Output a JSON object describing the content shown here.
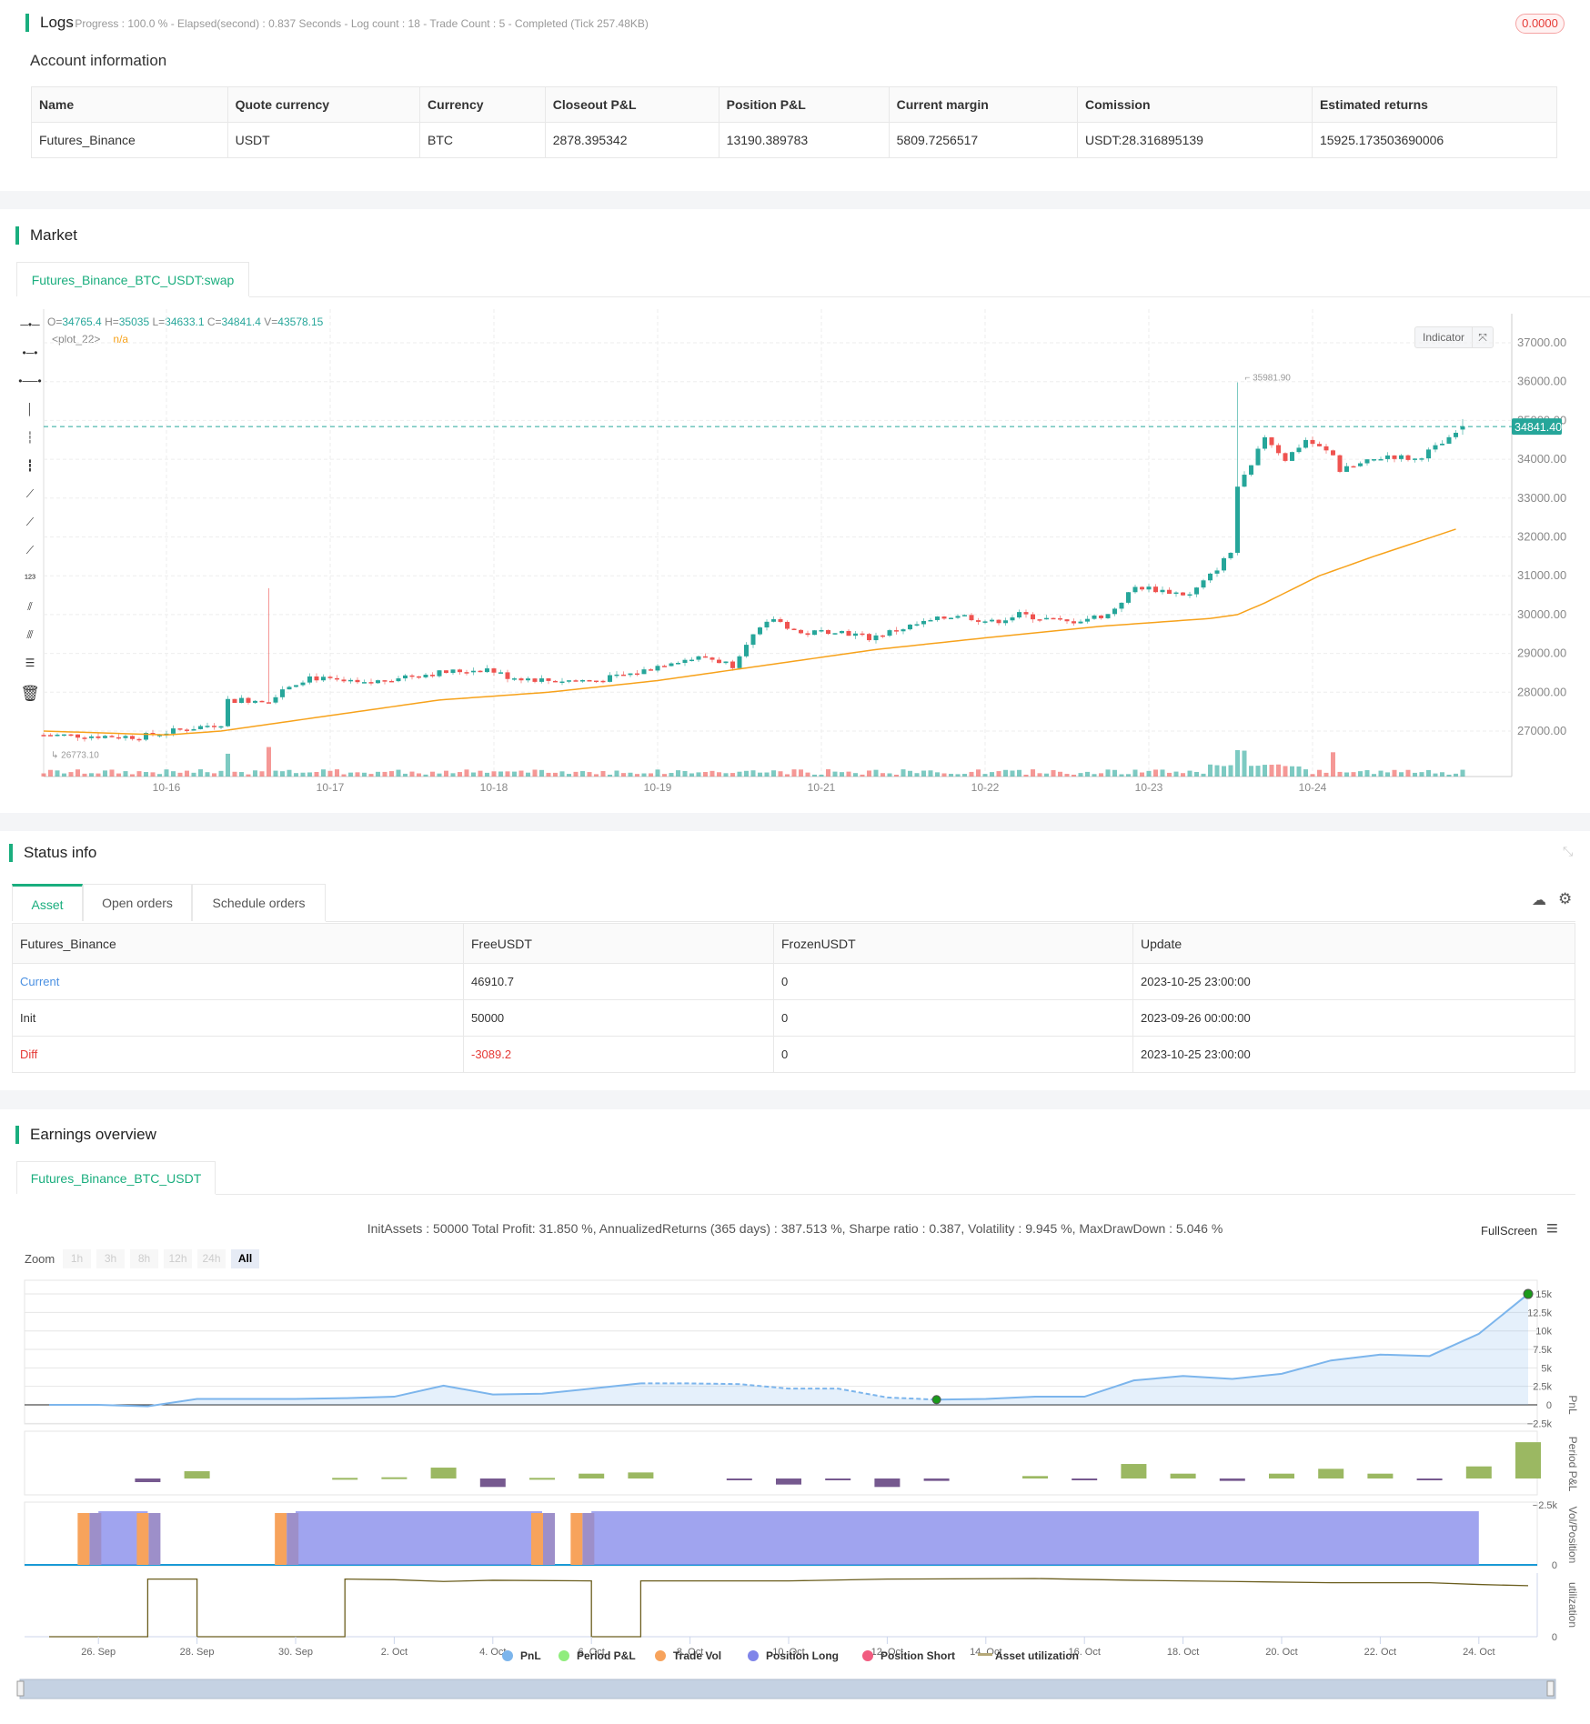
{
  "logs": {
    "title": "Logs",
    "progress": "- Progress : 100.0 % - Elapsed(second) : 0.837  Seconds - Log count : 18 - Trade Count : 5 - Completed (Tick 257.48KB)",
    "badge": "0.0000"
  },
  "account": {
    "title": "Account information",
    "headers": [
      "Name",
      "Quote currency",
      "Currency",
      "Closeout P&L",
      "Position P&L",
      "Current margin",
      "Comission",
      "Estimated returns"
    ],
    "row": [
      "Futures_Binance",
      "USDT",
      "BTC",
      "2878.395342",
      "13190.389783",
      "5809.7256517",
      "USDT:28.316895139",
      "15925.173503690006"
    ]
  },
  "market": {
    "title": "Market",
    "tab": "Futures_Binance_BTC_USDT:swap",
    "ohlc": {
      "o_label": "O=",
      "o": "34765.4",
      "h_label": " H=",
      "h": "35035",
      "l_label": " L=",
      "l": "34633.1",
      "c_label": " C=",
      "c": "34841.4",
      "v_label": " V=",
      "v": "43578.15"
    },
    "plot_label": "<plot_22>",
    "plot_value": "n/a",
    "indicator_btn": "Indicator",
    "last_price": "34841.40",
    "high_marker": "35981.90",
    "low_marker": "26773.10",
    "y_ticks": [
      37000,
      36000,
      35000,
      34000,
      33000,
      32000,
      31000,
      30000,
      29000,
      28000,
      27000
    ],
    "y_tick_labels": [
      "37000.00",
      "36000.00",
      "35000.00",
      "34000.00",
      "33000.00",
      "32000.00",
      "31000.00",
      "30000.00",
      "29000.00",
      "28000.00",
      "27000.00"
    ],
    "x_ticks": [
      {
        "h": 18,
        "label": "10-16"
      },
      {
        "h": 42,
        "label": "10-17"
      },
      {
        "h": 66,
        "label": "10-18"
      },
      {
        "h": 90,
        "label": "10-19"
      },
      {
        "h": 114,
        "label": "10-21"
      },
      {
        "h": 138,
        "label": "10-22"
      },
      {
        "h": 162,
        "label": "10-23"
      },
      {
        "h": 186,
        "label": "10-24"
      }
    ],
    "close_anchors": [
      [
        0,
        26900
      ],
      [
        14,
        26850
      ],
      [
        19,
        27000
      ],
      [
        26,
        27200
      ],
      [
        27,
        27800
      ],
      [
        33,
        27800
      ],
      [
        35,
        28100
      ],
      [
        39,
        28400
      ],
      [
        42,
        28300
      ],
      [
        47,
        28200
      ],
      [
        52,
        28400
      ],
      [
        58,
        28500
      ],
      [
        65,
        28600
      ],
      [
        68,
        28400
      ],
      [
        74,
        28300
      ],
      [
        81,
        28300
      ],
      [
        87,
        28500
      ],
      [
        92,
        28800
      ],
      [
        97,
        28900
      ],
      [
        101,
        28700
      ],
      [
        103,
        29300
      ],
      [
        107,
        29900
      ],
      [
        111,
        29500
      ],
      [
        116,
        29600
      ],
      [
        121,
        29400
      ],
      [
        127,
        29700
      ],
      [
        134,
        30000
      ],
      [
        139,
        29800
      ],
      [
        143,
        30000
      ],
      [
        150,
        29800
      ],
      [
        156,
        30000
      ],
      [
        160,
        30700
      ],
      [
        161,
        30700
      ],
      [
        168,
        30500
      ],
      [
        171,
        31000
      ],
      [
        174,
        31600
      ],
      [
        175,
        33300
      ],
      [
        177,
        33800
      ],
      [
        179,
        34600
      ],
      [
        182,
        34000
      ],
      [
        185,
        34500
      ],
      [
        189,
        34100
      ],
      [
        190,
        33700
      ],
      [
        197,
        34100
      ],
      [
        201,
        34000
      ],
      [
        206,
        34500
      ],
      [
        208,
        34841
      ]
    ],
    "ma_anchors": [
      [
        0,
        27000
      ],
      [
        18,
        26900
      ],
      [
        26,
        27000
      ],
      [
        42,
        27400
      ],
      [
        58,
        27800
      ],
      [
        74,
        28000
      ],
      [
        90,
        28300
      ],
      [
        106,
        28700
      ],
      [
        122,
        29100
      ],
      [
        138,
        29400
      ],
      [
        155,
        29700
      ],
      [
        171,
        29900
      ],
      [
        175,
        30000
      ],
      [
        179,
        30300
      ],
      [
        187,
        31000
      ],
      [
        195,
        31500
      ],
      [
        207,
        32200
      ]
    ],
    "spikes": [
      {
        "h": 33,
        "high": 30680
      },
      {
        "h": 175,
        "high": 35981.9
      }
    ],
    "colors": {
      "up": "#26a69a",
      "down": "#ef5350",
      "ma": "#f7a21b"
    }
  },
  "status": {
    "title": "Status info",
    "tabs": [
      "Asset",
      "Open orders",
      "Schedule orders"
    ],
    "headers": [
      "Futures_Binance",
      "FreeUSDT",
      "FrozenUSDT",
      "Update"
    ],
    "rows": [
      [
        "Current",
        "46910.7",
        "0",
        "2023-10-25 23:00:00"
      ],
      [
        "Init",
        "50000",
        "0",
        "2023-09-26 00:00:00"
      ],
      [
        "Diff",
        "-3089.2",
        "0",
        "2023-10-25 23:00:00"
      ]
    ]
  },
  "earnings": {
    "title": "Earnings overview",
    "tab": "Futures_Binance_BTC_USDT",
    "stats": "InitAssets : 50000 Total Profit: 31.850 %, AnnualizedReturns (365 days) : 387.513 %, Sharpe ratio : 0.387, Volatility : 9.945 %, MaxDrawDown : 5.046 %",
    "fullscreen": "FullScreen",
    "zoom_label": "Zoom",
    "zoom_buttons": [
      "1h",
      "3h",
      "8h",
      "12h",
      "24h",
      "All"
    ],
    "pnl_ticks": [
      {
        "v": 15000,
        "l": "15k"
      },
      {
        "v": 12500,
        "l": "12.5k"
      },
      {
        "v": 10000,
        "l": "10k"
      },
      {
        "v": 7500,
        "l": "7.5k"
      },
      {
        "v": 5000,
        "l": "5k"
      },
      {
        "v": 2500,
        "l": "2.5k"
      },
      {
        "v": 0,
        "l": "0"
      },
      {
        "v": -2500,
        "l": "−2.5k"
      }
    ],
    "axis_titles": [
      "PnL",
      "Period P&L",
      "Vol/Position",
      "utilization"
    ],
    "period_min_label": "−2.5k",
    "zero_label": "0",
    "x_labels": [
      {
        "d": 1,
        "l": "26. Sep"
      },
      {
        "d": 3,
        "l": "28. Sep"
      },
      {
        "d": 5,
        "l": "30. Sep"
      },
      {
        "d": 7,
        "l": "2. Oct"
      },
      {
        "d": 9,
        "l": "4. Oct"
      },
      {
        "d": 11,
        "l": "6. Oct"
      },
      {
        "d": 13,
        "l": "8. Oct"
      },
      {
        "d": 15,
        "l": "10. Oct"
      },
      {
        "d": 17,
        "l": "12. Oct"
      },
      {
        "d": 19,
        "l": "14. Oct"
      },
      {
        "d": 21,
        "l": "16. Oct"
      },
      {
        "d": 23,
        "l": "18. Oct"
      },
      {
        "d": 25,
        "l": "20. Oct"
      },
      {
        "d": 27,
        "l": "22. Oct"
      },
      {
        "d": 29,
        "l": "24. Oct"
      }
    ],
    "pnl": [
      0,
      0,
      -200,
      800,
      800,
      800,
      900,
      1100,
      2600,
      1400,
      1500,
      2200,
      2900,
      2900,
      2800,
      2200,
      2200,
      1000,
      700,
      800,
      1100,
      1100,
      3300,
      3900,
      3500,
      4200,
      6000,
      6800,
      6600,
      9600,
      15000
    ],
    "drawdown_range": [
      12,
      18
    ],
    "period_pnl": [
      [
        2,
        -300
      ],
      [
        3,
        600
      ],
      [
        6,
        50
      ],
      [
        7,
        100
      ],
      [
        8,
        900
      ],
      [
        9,
        -700
      ],
      [
        10,
        50
      ],
      [
        11,
        400
      ],
      [
        12,
        500
      ],
      [
        14,
        -100
      ],
      [
        15,
        -500
      ],
      [
        16,
        -100
      ],
      [
        17,
        -700
      ],
      [
        18,
        -200
      ],
      [
        20,
        200
      ],
      [
        21,
        -100
      ],
      [
        22,
        1200
      ],
      [
        23,
        400
      ],
      [
        24,
        -200
      ],
      [
        25,
        400
      ],
      [
        26,
        800
      ],
      [
        27,
        400
      ],
      [
        28,
        -100
      ],
      [
        29,
        1000
      ],
      [
        30,
        3000
      ]
    ],
    "positions_long": [
      [
        1,
        2
      ],
      [
        5,
        10
      ],
      [
        11,
        29
      ]
    ],
    "trade_vol": [
      0.8,
      2,
      4.8,
      10,
      10.8
    ],
    "utilization": [
      [
        0,
        0
      ],
      [
        2,
        0
      ],
      [
        2,
        0.96
      ],
      [
        3,
        0.96
      ],
      [
        3,
        0
      ],
      [
        6,
        0
      ],
      [
        6,
        0.96
      ],
      [
        7,
        0.95
      ],
      [
        8,
        0.92
      ],
      [
        9,
        0.94
      ],
      [
        11,
        0.93
      ],
      [
        11,
        0
      ],
      [
        12,
        0
      ],
      [
        12,
        0.93
      ],
      [
        15,
        0.93
      ],
      [
        17,
        0.96
      ],
      [
        20,
        0.97
      ],
      [
        22,
        0.94
      ],
      [
        24,
        0.92
      ],
      [
        26,
        0.9
      ],
      [
        28,
        0.9
      ],
      [
        29,
        0.87
      ],
      [
        30,
        0.85
      ]
    ],
    "legend": [
      {
        "l": "PnL",
        "c": "#7cb5ec"
      },
      {
        "l": "Period P&L",
        "c": "#90ed7d"
      },
      {
        "l": "Trade Vol",
        "c": "#f7a35c"
      },
      {
        "l": "Position Long",
        "c": "#8085e9"
      },
      {
        "l": "Position Short",
        "c": "#f15c80"
      },
      {
        "l": "Asset utilization",
        "c": "#b5a878"
      }
    ]
  }
}
